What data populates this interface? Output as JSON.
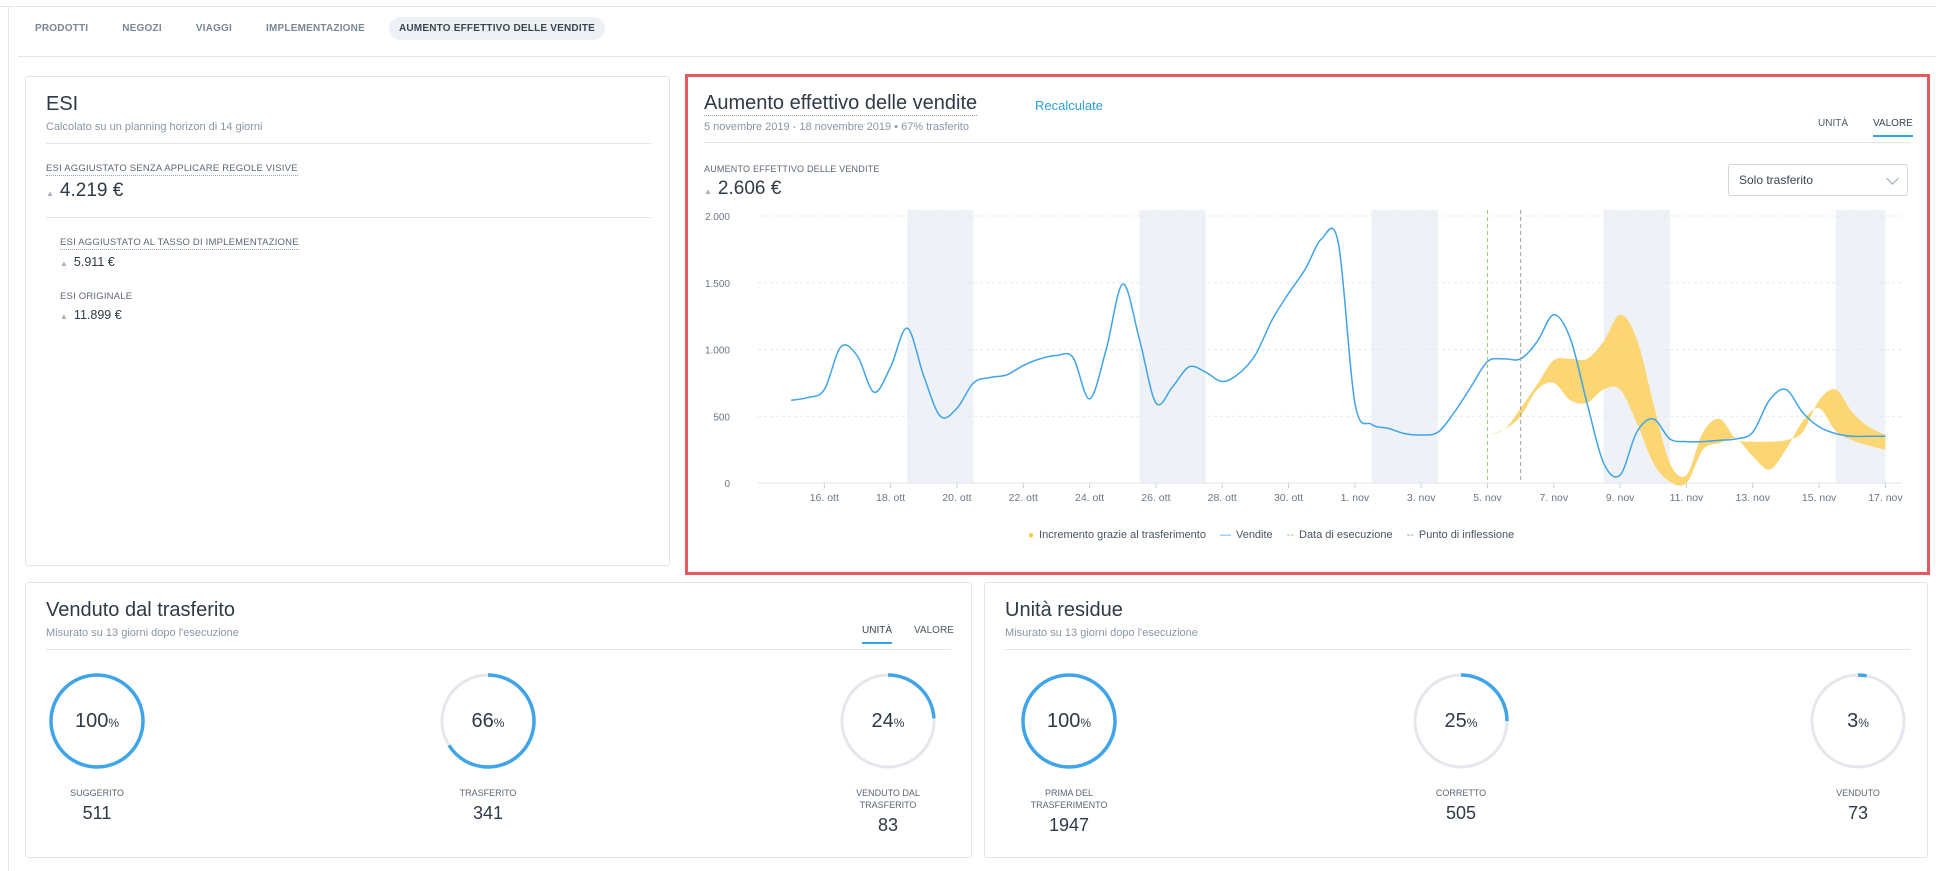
{
  "tabs": [
    "PRODOTTI",
    "NEGOZI",
    "VIAGGI",
    "IMPLEMENTAZIONE",
    "AUMENTO EFFETTIVO DELLE VENDITE"
  ],
  "active_tab": "AUMENTO EFFETTIVO DELLE VENDITE",
  "esi": {
    "title": "ESI",
    "subtitle": "Calcolato su un planning horizon di 14 giorni",
    "adjusted_label": "ESI AGGIUSTATO SENZA APPLICARE REGOLE VISIVE",
    "adjusted_value": "4.219 €",
    "impl_label": "ESI AGGIUSTATO AL TASSO DI IMPLEMENTAZIONE",
    "impl_value": "5.911 €",
    "orig_label": "ESI ORIGINALE",
    "orig_value": "11.899 €"
  },
  "uplift": {
    "title": "Aumento effettivo delle vendite",
    "recalc": "Recalculate",
    "subtitle": "5 novembre 2019 - 18 novembre 2019 • 67% trasferito",
    "toggle_units": "UNITÀ",
    "toggle_value": "VALORE",
    "metric_label": "AUMENTO EFFETTIVO DELLE VENDITE",
    "metric_value": "2.606 €",
    "select_value": "Solo trasferito",
    "legend": [
      "Incremento grazie al trasferimento",
      "Vendite",
      "Data di esecuzione",
      "Punto di inflessione"
    ]
  },
  "colors": {
    "accent": "#3fa4e8",
    "increment": "#fbd46b",
    "weekend": "#eef2f6",
    "highlight": "#e45a5e",
    "exec_line": "#9ccf7a",
    "inflection_line": "#9aa0a6"
  },
  "chart_data": {
    "type": "area",
    "ylim": [
      0,
      2000
    ],
    "yticks": [
      "2.000",
      "1.500",
      "1.000",
      "500",
      "0"
    ],
    "xticks": [
      "16. ott",
      "18. ott",
      "20. ott",
      "22. ott",
      "24. ott",
      "26. ott",
      "28. ott",
      "30. ott",
      "1. nov",
      "3. nov",
      "5. nov",
      "7. nov",
      "9. nov",
      "11. nov",
      "13. nov",
      "15. nov",
      "17. nov"
    ],
    "weekend_ranges": [
      [
        18.5,
        20.5
      ],
      [
        25.5,
        27.5
      ],
      [
        32.5,
        34.5
      ],
      [
        39.5,
        41.5
      ],
      [
        46.5,
        48
      ]
    ],
    "execution_day": 36,
    "inflection_day": 37,
    "series": [
      {
        "name": "Vendite",
        "x": [
          15,
          15.5,
          16,
          16.5,
          17,
          17.5,
          18,
          18.5,
          19,
          19.5,
          20,
          20.5,
          21,
          21.5,
          22,
          22.5,
          23,
          23.5,
          24,
          24.5,
          25,
          25.5,
          26,
          26.5,
          27,
          27.5,
          28,
          28.5,
          29,
          29.5,
          30,
          30.5,
          31,
          31.5,
          32,
          32.5,
          33,
          33.5,
          34,
          34.5,
          35,
          35.5,
          36,
          36.5,
          37,
          37.5,
          38,
          38.5,
          39,
          39.5,
          40,
          40.5,
          41,
          41.5,
          42,
          42.5,
          43,
          43.5,
          44,
          44.5,
          45,
          45.5,
          46,
          46.5,
          47,
          47.5,
          48
        ],
        "values": [
          620,
          640,
          700,
          1020,
          950,
          680,
          870,
          1160,
          800,
          500,
          560,
          750,
          790,
          810,
          880,
          930,
          955,
          940,
          630,
          1000,
          1490,
          1080,
          600,
          720,
          870,
          830,
          760,
          820,
          960,
          1220,
          1420,
          1600,
          1830,
          1800,
          600,
          440,
          410,
          370,
          360,
          380,
          530,
          720,
          910,
          930,
          930,
          1060,
          1260,
          1080,
          600,
          150,
          60,
          380,
          480,
          330,
          310,
          310,
          320,
          330,
          380,
          620,
          700,
          530,
          420,
          370,
          350,
          350,
          350
        ]
      },
      {
        "name": "Incremento grazie al trasferimento",
        "x": [
          36,
          36.5,
          37,
          37.5,
          38,
          38.5,
          39,
          39.5,
          40,
          40.5,
          41,
          41.5,
          42,
          42.5,
          43,
          43.5,
          44,
          44.5,
          45,
          45.5,
          46,
          46.5,
          47,
          47.5,
          48
        ],
        "lower": [
          360,
          400,
          500,
          700,
          750,
          620,
          600,
          700,
          700,
          450,
          150,
          10,
          0,
          250,
          300,
          330,
          200,
          100,
          250,
          460,
          560,
          390,
          320,
          280,
          250
        ],
        "upper": [
          360,
          400,
          560,
          740,
          920,
          930,
          930,
          1060,
          1260,
          1080,
          600,
          150,
          60,
          380,
          480,
          330,
          310,
          310,
          320,
          380,
          620,
          700,
          530,
          420,
          360
        ]
      }
    ]
  },
  "sold": {
    "title": "Venduto dal trasferito",
    "subtitle": "Misurato su 13 giorni dopo l'esecuzione",
    "toggle_units": "UNITÀ",
    "toggle_value": "VALORE",
    "gauges": [
      {
        "pct": 100,
        "label": "SUGGERITO",
        "value": "511"
      },
      {
        "pct": 66,
        "label": "TRASFERITO",
        "value": "341"
      },
      {
        "pct": 24,
        "label": "VENDUTO DAL TRASFERITO",
        "value": "83"
      }
    ]
  },
  "residual": {
    "title": "Unità residue",
    "subtitle": "Misurato su 13 giorni dopo l'esecuzione",
    "gauges": [
      {
        "pct": 100,
        "label": "PRIMA DEL TRASFERIMENTO",
        "value": "1947"
      },
      {
        "pct": 25,
        "label": "CORRETTO",
        "value": "505"
      },
      {
        "pct": 3,
        "label": "VENDUTO",
        "value": "73"
      }
    ]
  }
}
